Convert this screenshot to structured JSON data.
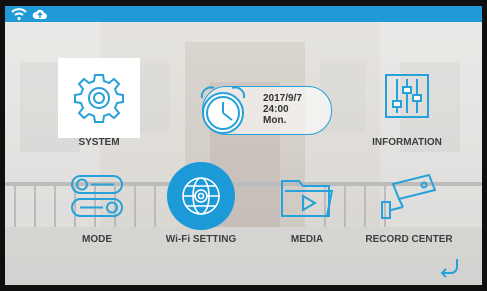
{
  "status": {
    "icons": [
      "wifi-icon",
      "cloud-upload-icon"
    ],
    "bar_color": "#1f9ad6"
  },
  "clock": {
    "date": "2017/9/7",
    "time": "24:00",
    "day": "Mon."
  },
  "menu": {
    "system": "SYSTEM",
    "information": "INFORMATION",
    "mode": "MODE",
    "wifi_setting": "Wi-Fi SETTING",
    "media": "MEDIA",
    "record_center": "RECORD CENTER"
  },
  "colors": {
    "accent": "#1b9ad7",
    "label": "#3e3e3e"
  }
}
